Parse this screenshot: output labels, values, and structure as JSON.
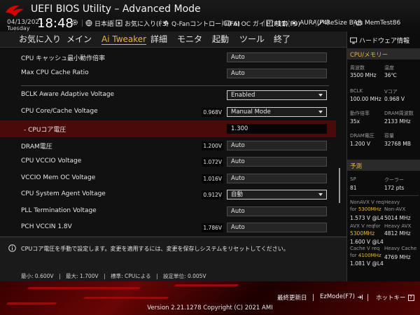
{
  "header": {
    "title": "UEFI BIOS Utility – Advanced Mode",
    "date": "04/13/2021",
    "day": "Tuesday",
    "time": "18:48",
    "toolbar": [
      {
        "icon": "globe-icon",
        "label": "日本語"
      },
      {
        "icon": "star-icon",
        "label": "お気に入り(F3)"
      },
      {
        "icon": "fan-icon",
        "label": "Q-Fanコントロール(F6)"
      },
      {
        "icon": "ai-oc-icon",
        "label": "AI OC ガイド(F11)"
      },
      {
        "icon": "question-icon",
        "label": "検索(F9)"
      },
      {
        "icon": "aura-icon",
        "label": "AURA(F4)"
      },
      {
        "icon": "resize-bar-icon",
        "label": "ReSize BAR"
      },
      {
        "icon": "memtest-icon",
        "label": "MemTest86"
      }
    ]
  },
  "tabs": [
    {
      "label": "お気に入り",
      "active": false
    },
    {
      "label": "メイン",
      "active": false
    },
    {
      "label": "Ai Tweaker",
      "active": true
    },
    {
      "label": "詳細",
      "active": false
    },
    {
      "label": "モニタ",
      "active": false
    },
    {
      "label": "起動",
      "active": false
    },
    {
      "label": "ツール",
      "active": false
    },
    {
      "label": "終了",
      "active": false
    }
  ],
  "settings": [
    {
      "label": "CPU キャッシュ最小動作倍率",
      "value": "Auto",
      "current": "",
      "type": "field"
    },
    {
      "label": "Max CPU Cache Ratio",
      "value": "Auto",
      "current": "",
      "type": "field"
    },
    {
      "label": "BCLK Aware Adaptive Voltage",
      "value": "Enabled",
      "current": "",
      "type": "select"
    },
    {
      "label": "CPU Core/Cache Voltage",
      "value": "Manual Mode",
      "current": "0.968V",
      "type": "select"
    },
    {
      "label": "- CPUコア電圧",
      "value": "1.300",
      "current": "",
      "type": "field"
    },
    {
      "label": "DRAM電圧",
      "value": "Auto",
      "current": "1.200V",
      "type": "field"
    },
    {
      "label": "CPU VCCIO Voltage",
      "value": "Auto",
      "current": "1.072V",
      "type": "field"
    },
    {
      "label": "VCCIO Mem OC Voltage",
      "value": "Auto",
      "current": "1.016V",
      "type": "field"
    },
    {
      "label": "CPU System Agent Voltage",
      "value": "自動",
      "current": "0.912V",
      "type": "select"
    },
    {
      "label": "PLL Termination Voltage",
      "value": "Auto",
      "current": "",
      "type": "field"
    },
    {
      "label": "PCH VCCIN 1.8V",
      "value": "Auto",
      "current": "1.786V",
      "type": "field"
    }
  ],
  "help": {
    "text": "CPUコア電圧を手動で設定します。変更を適用するには、変更を保存しシステムをリセットしてください。",
    "range": "最小: 0.600V　|　最大: 1.700V　|　標準: CPUによる　|　設定単位: 0.005V"
  },
  "hw": {
    "title": "ハードウェア情報",
    "cpu_section": "CPU/メモリー",
    "cpu": [
      {
        "k1": "周波数",
        "v1": "3500 MHz",
        "k2": "温度",
        "v2": "36℃"
      },
      {
        "k1": "BCLK",
        "v1": "100.00 MHz",
        "k2": "Vコア",
        "v2": "0.968 V"
      },
      {
        "k1": "動作倍率",
        "v1": "35x",
        "k2": "DRAM周波数",
        "v2": "2133 MHz"
      },
      {
        "k1": "DRAM電圧",
        "v1": "1.200 V",
        "k2": "容量",
        "v2": "32768 MB"
      }
    ],
    "pred_section": "予測",
    "sp_k": "SP",
    "sp_v": "81",
    "cooler_k": "クーラー",
    "cooler_v": "172 pts",
    "nonavx_k1": "NonAVX V req",
    "nonavx_for": "for",
    "nonavx_freq": "5300MHz",
    "nonavx_v": "1.573 V @L4",
    "nonavx_k2a": "Heavy",
    "nonavx_k2b": "Non-AVX",
    "nonavx_v2": "5014 MHz",
    "avx_k1": "AVX V req",
    "avx_for": "for",
    "avx_freq": "5300MHz",
    "avx_v": "1.600 V @L4",
    "avx_k2": "Heavy AVX",
    "avx_v2": "4812 MHz",
    "cache_k1": "Cache V req",
    "cache_for": "for",
    "cache_freq": "4100MHz",
    "cache_v": "1.081 V @L4",
    "cache_k2": "Heavy Cache",
    "cache_v2": "4769 MHz"
  },
  "footer": {
    "last_modified": "最終更新日",
    "ezmode": "EzMode(F7)",
    "hotkey": "ホットキー",
    "hotkey_symbol": "?",
    "version": "Version 2.21.1278 Copyright (C) 2021 AMI"
  },
  "colors": {
    "accent": "#e8b53a",
    "highlight_row": "#4a0a0a",
    "footer_red": "#6a0505"
  }
}
